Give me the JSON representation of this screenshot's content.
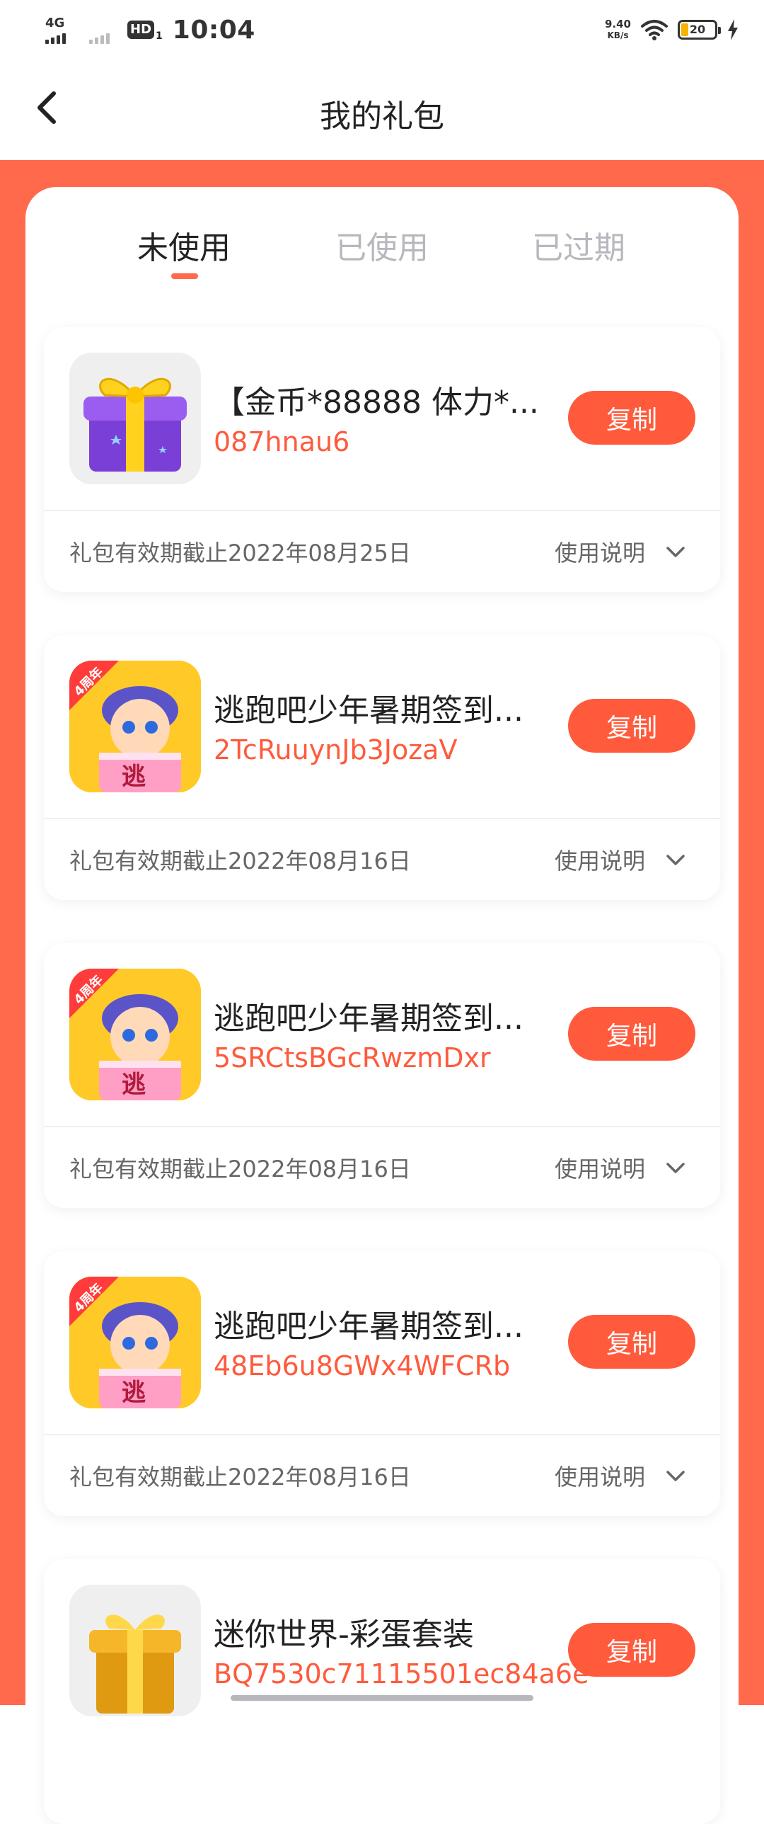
{
  "status_bar": {
    "network": "4G",
    "hd": "HD",
    "hd_sub": "1",
    "time": "10:04",
    "speed_value": "9.40",
    "speed_unit": "KB/s",
    "battery": "20"
  },
  "header": {
    "title": "我的礼包",
    "back_icon": "chevron-left-icon"
  },
  "tabs": [
    {
      "label": "未使用",
      "active": true
    },
    {
      "label": "已使用",
      "active": false
    },
    {
      "label": "已过期",
      "active": false
    }
  ],
  "gifts": [
    {
      "name": "【金币*88888 体力*...",
      "code": "087hnau6",
      "copy_label": "复制",
      "expiry": "礼包有效期截止2022年08月25日",
      "usage_label": "使用说明",
      "icon": "gift-box-icon"
    },
    {
      "name": "逃跑吧少年暑期签到...",
      "code": "2TcRuuynJb3JozaV",
      "copy_label": "复制",
      "expiry": "礼包有效期截止2022年08月16日",
      "usage_label": "使用说明",
      "icon": "game-icon",
      "icon_badge": "4周年",
      "icon_text": "逃"
    },
    {
      "name": "逃跑吧少年暑期签到...",
      "code": "5SRCtsBGcRwzmDxr",
      "copy_label": "复制",
      "expiry": "礼包有效期截止2022年08月16日",
      "usage_label": "使用说明",
      "icon": "game-icon",
      "icon_badge": "4周年",
      "icon_text": "逃"
    },
    {
      "name": "逃跑吧少年暑期签到...",
      "code": "48Eb6u8GWx4WFCRb",
      "copy_label": "复制",
      "expiry": "礼包有效期截止2022年08月16日",
      "usage_label": "使用说明",
      "icon": "game-icon",
      "icon_badge": "4周年",
      "icon_text": "逃"
    },
    {
      "name": "迷你世界-彩蛋套装",
      "code": "BQ7530c71115501ec84a6e",
      "copy_label": "复制",
      "icon": "gift-box-icon"
    }
  ],
  "colors": {
    "accent": "#ff5a3c",
    "background_orange": "#ff6a4d",
    "tab_inactive": "#b7b7bd"
  }
}
